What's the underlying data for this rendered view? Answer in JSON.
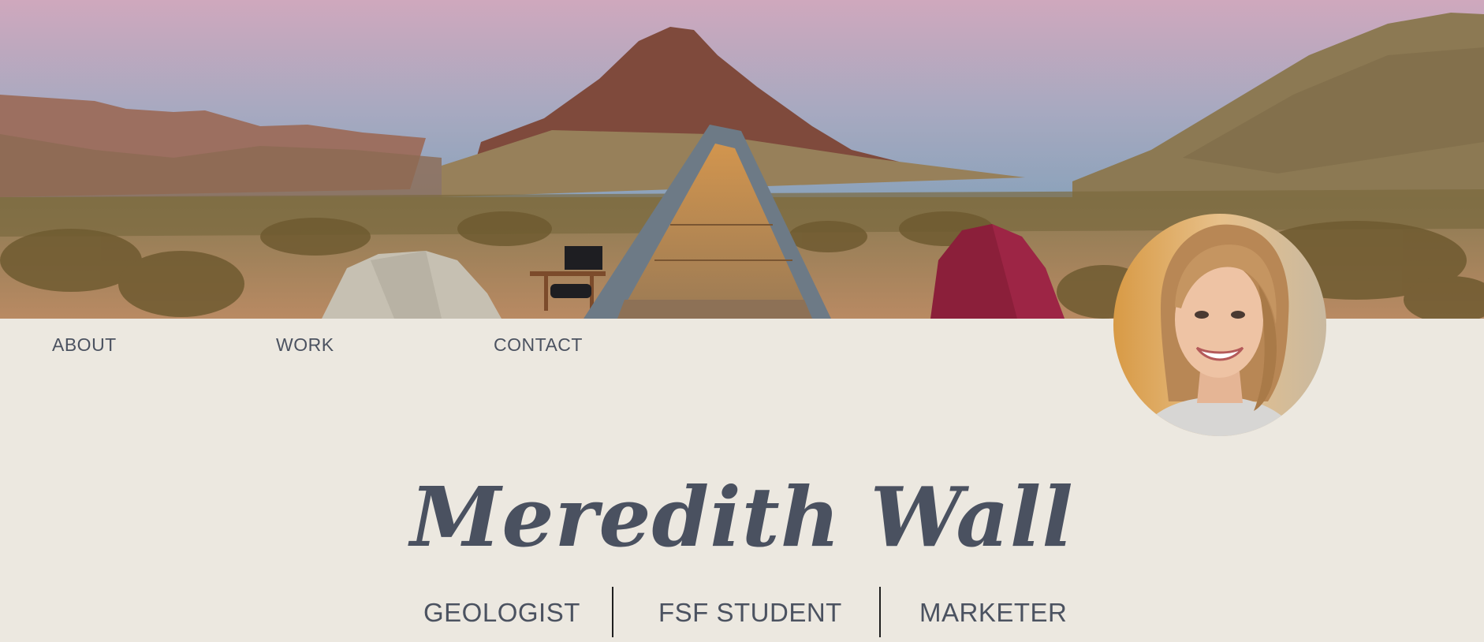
{
  "nav": {
    "items": [
      {
        "label": "ABOUT"
      },
      {
        "label": "WORK"
      },
      {
        "label": "CONTACT"
      }
    ]
  },
  "profile": {
    "name": "Meredith Wall",
    "avatar_icon": "profile-photo"
  },
  "roles": [
    {
      "label": "GEOLOGIST"
    },
    {
      "label": "FSF STUDENT"
    },
    {
      "label": "MARKETER"
    }
  ],
  "hero": {
    "image": "desert-campsite-banner"
  },
  "colors": {
    "background": "#ece8e0",
    "text": "#4b5260",
    "name": "#4a5160",
    "divider": "#1f1f1f"
  }
}
